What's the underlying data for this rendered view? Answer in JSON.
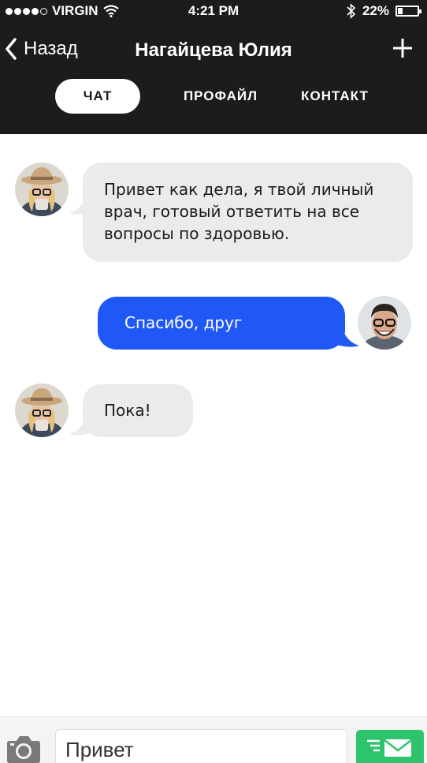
{
  "status_bar": {
    "carrier": "VIRGIN",
    "time": "4:21 PM",
    "battery": "22%",
    "battery_level": 0.22,
    "signal_bars": 4
  },
  "nav": {
    "back_label": "Назад",
    "title": "Нагайцева Юлия",
    "add_icon": "plus-icon"
  },
  "tabs": [
    {
      "label": "ЧАТ",
      "active": true
    },
    {
      "label": "ПРОФАЙЛ",
      "active": false
    },
    {
      "label": "КОНТАКТ",
      "active": false
    }
  ],
  "messages": [
    {
      "from": "contact",
      "lines": [
        "Привет как дела, я твой личный",
        "врач, готовый ответить на все",
        "вопросы по здоровью."
      ]
    },
    {
      "from": "me",
      "lines": [
        "Спасибо, друг"
      ]
    },
    {
      "from": "contact",
      "lines": [
        "Пока!"
      ]
    }
  ],
  "composer": {
    "value": "Привет",
    "camera_icon": "camera-icon",
    "send_icon": "send-mail-icon"
  },
  "colors": {
    "header_bg": "#1b1c1e",
    "incoming_bubble": "#ebebeb",
    "outgoing_bubble": "#2058f6",
    "send_button": "#2ec46b"
  }
}
